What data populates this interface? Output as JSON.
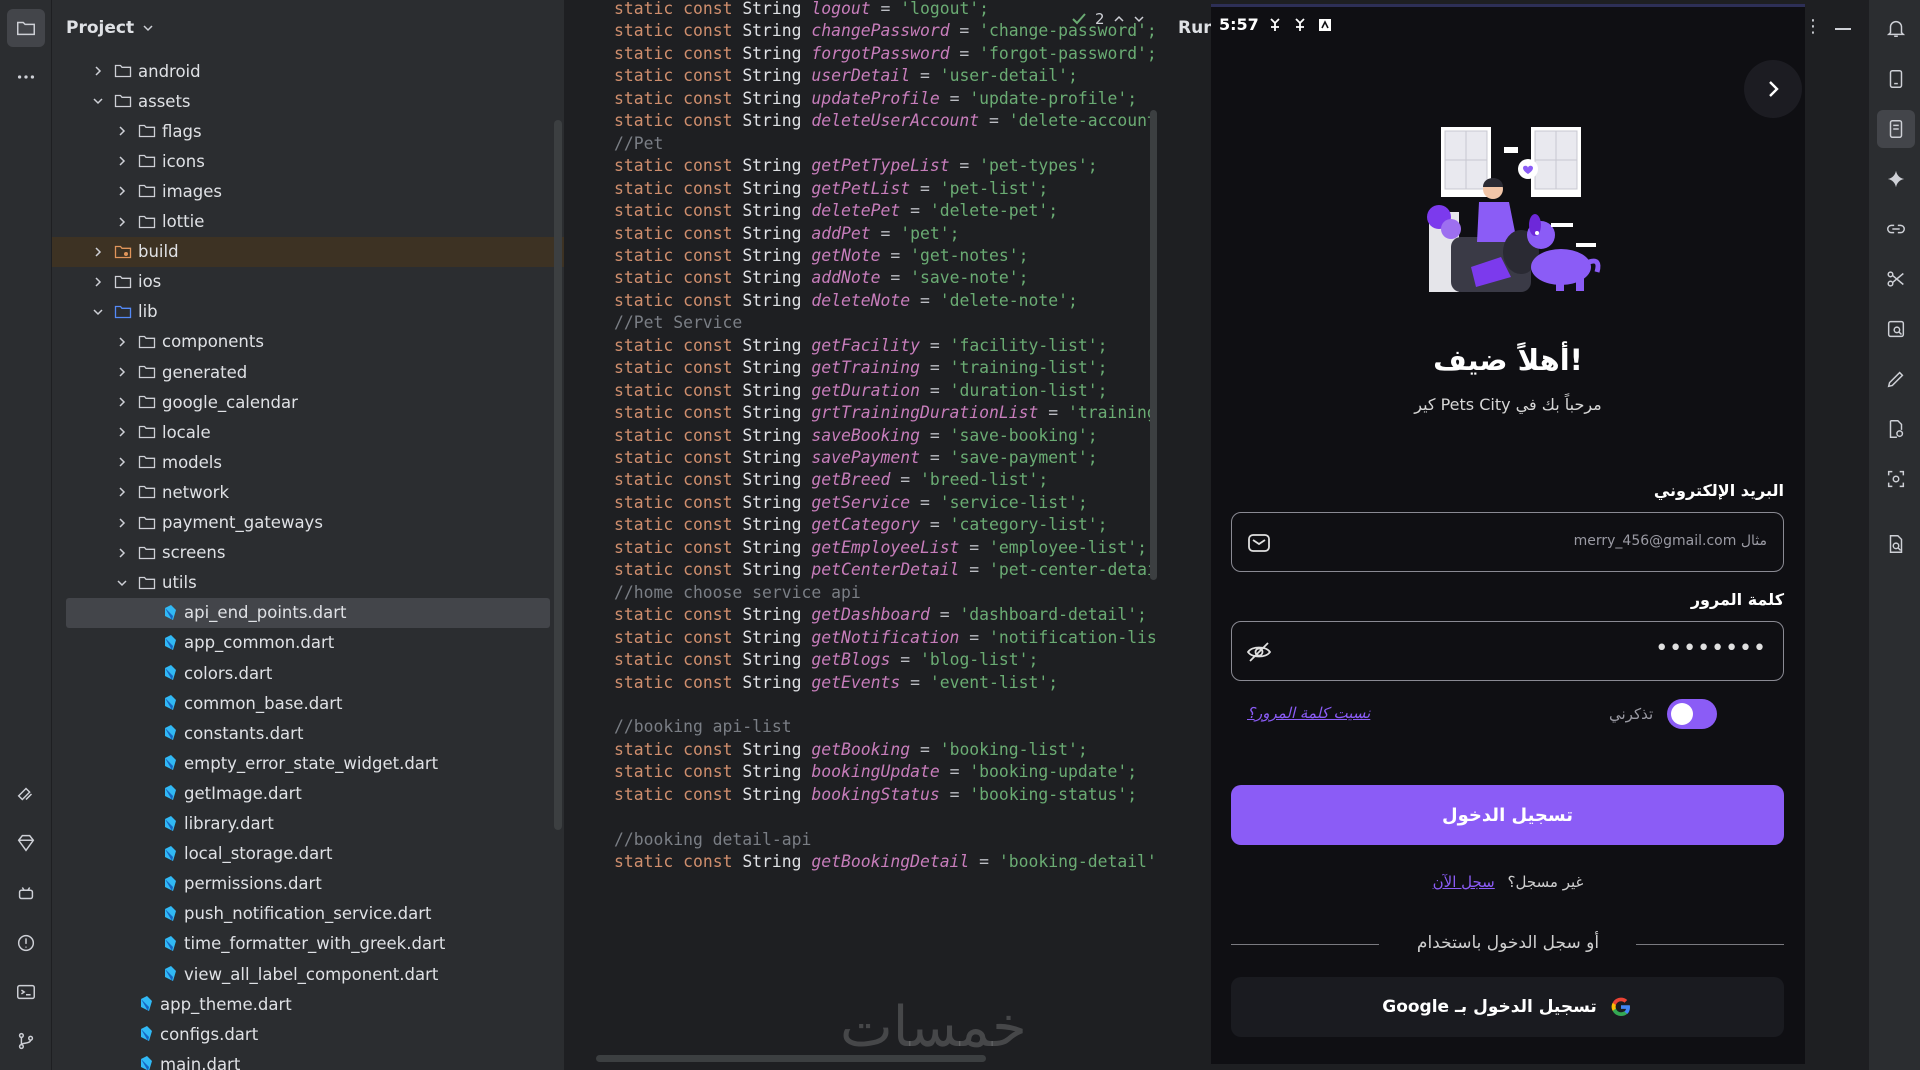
{
  "project_panel": {
    "title": "Project",
    "tree": [
      {
        "label": "android",
        "kind": "folder",
        "depth": 1,
        "expanded": false
      },
      {
        "label": "assets",
        "kind": "folder",
        "depth": 1,
        "expanded": true
      },
      {
        "label": "flags",
        "kind": "folder",
        "depth": 2,
        "expanded": false
      },
      {
        "label": "icons",
        "kind": "folder",
        "depth": 2,
        "expanded": false
      },
      {
        "label": "images",
        "kind": "folder",
        "depth": 2,
        "expanded": false
      },
      {
        "label": "lottie",
        "kind": "folder",
        "depth": 2,
        "expanded": false
      },
      {
        "label": "build",
        "kind": "excluded-folder",
        "depth": 1,
        "expanded": false
      },
      {
        "label": "ios",
        "kind": "folder",
        "depth": 1,
        "expanded": false
      },
      {
        "label": "lib",
        "kind": "source-folder",
        "depth": 1,
        "expanded": true
      },
      {
        "label": "components",
        "kind": "folder",
        "depth": 2,
        "expanded": false
      },
      {
        "label": "generated",
        "kind": "folder",
        "depth": 2,
        "expanded": false
      },
      {
        "label": "google_calendar",
        "kind": "folder",
        "depth": 2,
        "expanded": false
      },
      {
        "label": "locale",
        "kind": "folder",
        "depth": 2,
        "expanded": false
      },
      {
        "label": "models",
        "kind": "folder",
        "depth": 2,
        "expanded": false
      },
      {
        "label": "network",
        "kind": "folder",
        "depth": 2,
        "expanded": false
      },
      {
        "label": "payment_gateways",
        "kind": "folder",
        "depth": 2,
        "expanded": false
      },
      {
        "label": "screens",
        "kind": "folder",
        "depth": 2,
        "expanded": false
      },
      {
        "label": "utils",
        "kind": "folder",
        "depth": 2,
        "expanded": true
      },
      {
        "label": "api_end_points.dart",
        "kind": "dart",
        "depth": 3,
        "selected": true
      },
      {
        "label": "app_common.dart",
        "kind": "dart",
        "depth": 3
      },
      {
        "label": "colors.dart",
        "kind": "dart",
        "depth": 3
      },
      {
        "label": "common_base.dart",
        "kind": "dart",
        "depth": 3
      },
      {
        "label": "constants.dart",
        "kind": "dart",
        "depth": 3
      },
      {
        "label": "empty_error_state_widget.dart",
        "kind": "dart",
        "depth": 3
      },
      {
        "label": "getImage.dart",
        "kind": "dart",
        "depth": 3
      },
      {
        "label": "library.dart",
        "kind": "dart",
        "depth": 3
      },
      {
        "label": "local_storage.dart",
        "kind": "dart",
        "depth": 3
      },
      {
        "label": "permissions.dart",
        "kind": "dart",
        "depth": 3
      },
      {
        "label": "push_notification_service.dart",
        "kind": "dart",
        "depth": 3
      },
      {
        "label": "time_formatter_with_greek.dart",
        "kind": "dart",
        "depth": 3
      },
      {
        "label": "view_all_label_component.dart",
        "kind": "dart",
        "depth": 3
      },
      {
        "label": "app_theme.dart",
        "kind": "dart",
        "depth": 2
      },
      {
        "label": "configs.dart",
        "kind": "dart",
        "depth": 2
      },
      {
        "label": "main.dart",
        "kind": "dart",
        "depth": 2
      }
    ]
  },
  "editor": {
    "inspection_count": "2",
    "lines": [
      {
        "t": "decl",
        "name": "logout",
        "value": "'logout';"
      },
      {
        "t": "decl",
        "name": "changePassword",
        "value": "'change-password';"
      },
      {
        "t": "decl",
        "name": "forgotPassword",
        "value": "'forgot-password';"
      },
      {
        "t": "decl",
        "name": "userDetail",
        "value": "'user-detail';"
      },
      {
        "t": "decl",
        "name": "updateProfile",
        "value": "'update-profile';"
      },
      {
        "t": "decl",
        "name": "deleteUserAccount",
        "value": "'delete-account"
      },
      {
        "t": "comment",
        "text": "//Pet"
      },
      {
        "t": "decl",
        "name": "getPetTypeList",
        "value": "'pet-types';"
      },
      {
        "t": "decl",
        "name": "getPetList",
        "value": "'pet-list';"
      },
      {
        "t": "decl",
        "name": "deletePet",
        "value": "'delete-pet';"
      },
      {
        "t": "decl",
        "name": "addPet",
        "value": "'pet';"
      },
      {
        "t": "decl",
        "name": "getNote",
        "value": "'get-notes';"
      },
      {
        "t": "decl",
        "name": "addNote",
        "value": "'save-note';"
      },
      {
        "t": "decl",
        "name": "deleteNote",
        "value": "'delete-note';"
      },
      {
        "t": "comment",
        "text": "//Pet Service"
      },
      {
        "t": "decl",
        "name": "getFacility",
        "value": "'facility-list';"
      },
      {
        "t": "decl",
        "name": "getTraining",
        "value": "'training-list';"
      },
      {
        "t": "decl",
        "name": "getDuration",
        "value": "'duration-list';"
      },
      {
        "t": "decl",
        "name": "grtTrainingDurationList",
        "value": "'training"
      },
      {
        "t": "decl",
        "name": "saveBooking",
        "value": "'save-booking';"
      },
      {
        "t": "decl",
        "name": "savePayment",
        "value": "'save-payment';"
      },
      {
        "t": "decl",
        "name": "getBreed",
        "value": "'breed-list';"
      },
      {
        "t": "decl",
        "name": "getService",
        "value": "'service-list';"
      },
      {
        "t": "decl",
        "name": "getCategory",
        "value": "'category-list';"
      },
      {
        "t": "decl",
        "name": "getEmployeeList",
        "value": "'employee-list';"
      },
      {
        "t": "decl",
        "name": "petCenterDetail",
        "value": "'pet-center-detai"
      },
      {
        "t": "comment",
        "text": "//home choose service api"
      },
      {
        "t": "decl",
        "name": "getDashboard",
        "value": "'dashboard-detail';"
      },
      {
        "t": "decl",
        "name": "getNotification",
        "value": "'notification-lis"
      },
      {
        "t": "decl",
        "name": "getBlogs",
        "value": "'blog-list';"
      },
      {
        "t": "decl",
        "name": "getEvents",
        "value": "'event-list';"
      },
      {
        "t": "blank"
      },
      {
        "t": "comment",
        "text": "//booking api-list"
      },
      {
        "t": "decl",
        "name": "getBooking",
        "value": "'booking-list';"
      },
      {
        "t": "decl",
        "name": "bookingUpdate",
        "value": "'booking-update';"
      },
      {
        "t": "decl",
        "name": "bookingStatus",
        "value": "'booking-status';"
      },
      {
        "t": "blank"
      },
      {
        "t": "comment",
        "text": "//booking detail-api"
      },
      {
        "t": "decl",
        "name": "getBookingDetail",
        "value": "'booking-detail'"
      }
    ],
    "keyword_static": "static",
    "keyword_const": "const",
    "type_name": "String",
    "watermark": "خمسات"
  },
  "run_panel": {
    "title": "Run"
  },
  "phone": {
    "status_time": "5:57",
    "welcome_title": "أهلاً ضيف!",
    "welcome_subtitle": "مرحباً بك في Pets City كير",
    "email_label": "البريد الإلكتروني",
    "email_placeholder": "مثال merry_456@gmail.com",
    "password_label": "كلمة المرور",
    "password_value": "••••••••",
    "remember_label": "تذكرني",
    "forgot_link": "نسيت كلمة المرور؟",
    "signin_button": "تسجيل الدخول",
    "register_question": "غير مسجل؟",
    "register_link": "سجل الآن",
    "or_text": "أو سجل الدخول باستخدام",
    "google_button": "تسجيل الدخول بـ Google",
    "accent_color": "#8b5cf6",
    "remember_on": true
  }
}
